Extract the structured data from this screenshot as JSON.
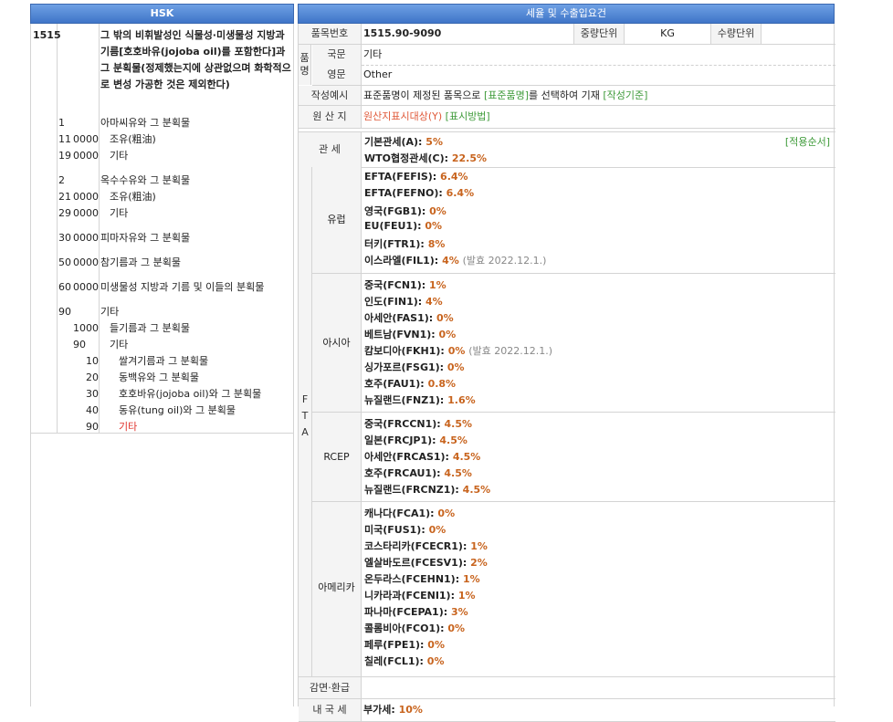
{
  "left_header": "HSK",
  "right_header": "세율 및 수출입요건",
  "hsk": {
    "code": "1515",
    "desc": "그 밖의 비휘발성인 식물성·미생물성 지방과 기름[호호바유(jojoba oil)를 포함한다]과 그 분획물(정제했는지에 상관없으며 화학적으로 변성 가공한 것은 제외한다)"
  },
  "rows": [
    {
      "c1": "1",
      "c2": "",
      "c3": "",
      "label": "아마씨유와 그 분획물",
      "indent": 0
    },
    {
      "c1": "11",
      "c2": "00",
      "c3": "00",
      "label": "조유(粗油)",
      "indent": 1
    },
    {
      "c1": "19",
      "c2": "00",
      "c3": "00",
      "label": "기타",
      "indent": 1
    },
    {
      "c1": "2",
      "c2": "",
      "c3": "",
      "label": "옥수수유와 그 분획물",
      "indent": 0
    },
    {
      "c1": "21",
      "c2": "00",
      "c3": "00",
      "label": "조유(粗油)",
      "indent": 1
    },
    {
      "c1": "29",
      "c2": "00",
      "c3": "00",
      "label": "기타",
      "indent": 1
    },
    {
      "c1": "30",
      "c2": "00",
      "c3": "00",
      "label": "피마자유와 그 분획물",
      "indent": 0
    },
    {
      "c1": "50",
      "c2": "00",
      "c3": "00",
      "label": "참기름과 그 분획물",
      "indent": 0
    },
    {
      "c1": "60",
      "c2": "00",
      "c3": "00",
      "label": "미생물성 지방과 기름 및 이들의 분획물",
      "indent": 0
    },
    {
      "c1": "90",
      "c2": "",
      "c3": "",
      "label": "기타",
      "indent": 0
    },
    {
      "c1": "",
      "c2": "10",
      "c3": "00",
      "label": "들기름과 그 분획물",
      "indent": 1
    },
    {
      "c1": "",
      "c2": "90",
      "c3": "",
      "label": "기타",
      "indent": 1
    },
    {
      "c1": "",
      "c2": "",
      "c3": "10",
      "label": "쌀겨기름과 그 분획물",
      "indent": 2
    },
    {
      "c1": "",
      "c2": "",
      "c3": "20",
      "label": "동백유와 그 분획물",
      "indent": 2
    },
    {
      "c1": "",
      "c2": "",
      "c3": "30",
      "label": "호호바유(jojoba oil)와 그 분획물",
      "indent": 2
    },
    {
      "c1": "",
      "c2": "",
      "c3": "40",
      "label": "동유(tung oil)와 그 분획물",
      "indent": 2
    },
    {
      "c1": "",
      "c2": "",
      "c3": "90",
      "label": "기타",
      "indent": 2,
      "selected": true
    }
  ],
  "item": {
    "no_label": "품목번호",
    "no_value": "1515.90-9090",
    "weight_label": "중량단위",
    "weight_value": "KG",
    "qty_label": "수량단위",
    "qty_value": ""
  },
  "name": {
    "group_label": "품명",
    "kr_label": "국문",
    "kr_value": "기타",
    "en_label": "영문",
    "en_value": "Other",
    "example_label": "작성예시",
    "example_text": "표준품명이 제정된 품목으로",
    "example_link1": "[표준품명]",
    "example_text2": "를 선택하여 기재",
    "example_link2": "[작성기준]"
  },
  "origin": {
    "label": "원 산 지",
    "value": "원산지표시대상(Y)",
    "link": "[표시방법]"
  },
  "tariff": {
    "label": "관 세",
    "link": "[적용순서]",
    "lines": [
      {
        "name": "기본관세(A):",
        "rate": "5%"
      },
      {
        "name": "WTO협정관세(C):",
        "rate": "22.5%"
      }
    ]
  },
  "fta": {
    "label": "FTA",
    "groups": [
      {
        "name": "유럽",
        "lines": [
          {
            "name": "EFTA(FEFIS):",
            "rate": "6.4%",
            "note": ""
          },
          {
            "name": "EFTA(FEFNO):",
            "rate": "6.4%",
            "note": ""
          },
          {
            "name": "영국(FGB1):",
            "rate": "0%",
            "note": ""
          },
          {
            "name": "EU(FEU1):",
            "rate": "0%",
            "note": ""
          },
          {
            "name": "터키(FTR1):",
            "rate": "8%",
            "note": ""
          },
          {
            "name": "이스라엘(FIL1):",
            "rate": "4%",
            "note": "(발효 2022.12.1.)"
          }
        ]
      },
      {
        "name": "아시아",
        "lines": [
          {
            "name": "중국(FCN1):",
            "rate": "1%",
            "note": ""
          },
          {
            "name": "인도(FIN1):",
            "rate": "4%",
            "note": ""
          },
          {
            "name": "아세안(FAS1):",
            "rate": "0%",
            "note": ""
          },
          {
            "name": "베트남(FVN1):",
            "rate": "0%",
            "note": ""
          },
          {
            "name": "캄보디아(FKH1):",
            "rate": "0%",
            "note": "(발효 2022.12.1.)"
          },
          {
            "name": "싱가포르(FSG1):",
            "rate": "0%",
            "note": ""
          },
          {
            "name": "호주(FAU1):",
            "rate": "0.8%",
            "note": ""
          },
          {
            "name": "뉴질랜드(FNZ1):",
            "rate": "1.6%",
            "note": ""
          }
        ]
      },
      {
        "name": "RCEP",
        "lines": [
          {
            "name": "중국(FRCCN1):",
            "rate": "4.5%",
            "note": ""
          },
          {
            "name": "일본(FRCJP1):",
            "rate": "4.5%",
            "note": ""
          },
          {
            "name": "아세안(FRCAS1):",
            "rate": "4.5%",
            "note": ""
          },
          {
            "name": "호주(FRCAU1):",
            "rate": "4.5%",
            "note": ""
          },
          {
            "name": "뉴질랜드(FRCNZ1):",
            "rate": "4.5%",
            "note": ""
          }
        ]
      },
      {
        "name": "아메리카",
        "lines": [
          {
            "name": "캐나다(FCA1):",
            "rate": "0%",
            "note": ""
          },
          {
            "name": "미국(FUS1):",
            "rate": "0%",
            "note": ""
          },
          {
            "name": "코스타리카(FCECR1):",
            "rate": "1%",
            "note": ""
          },
          {
            "name": "엘살바도르(FCESV1):",
            "rate": "2%",
            "note": ""
          },
          {
            "name": "온두라스(FCEHN1):",
            "rate": "1%",
            "note": ""
          },
          {
            "name": "니카라과(FCENI1):",
            "rate": "1%",
            "note": ""
          },
          {
            "name": "파나마(FCEPA1):",
            "rate": "3%",
            "note": ""
          },
          {
            "name": "콜롬비아(FCO1):",
            "rate": "0%",
            "note": ""
          },
          {
            "name": "페루(FPE1):",
            "rate": "0%",
            "note": ""
          },
          {
            "name": "칠레(FCL1):",
            "rate": "0%",
            "note": ""
          }
        ]
      }
    ]
  },
  "reduction": {
    "label": "감면·환급",
    "value": ""
  },
  "domestic": {
    "label": "내 국 세",
    "value": "부가세:",
    "rate": "10%"
  }
}
